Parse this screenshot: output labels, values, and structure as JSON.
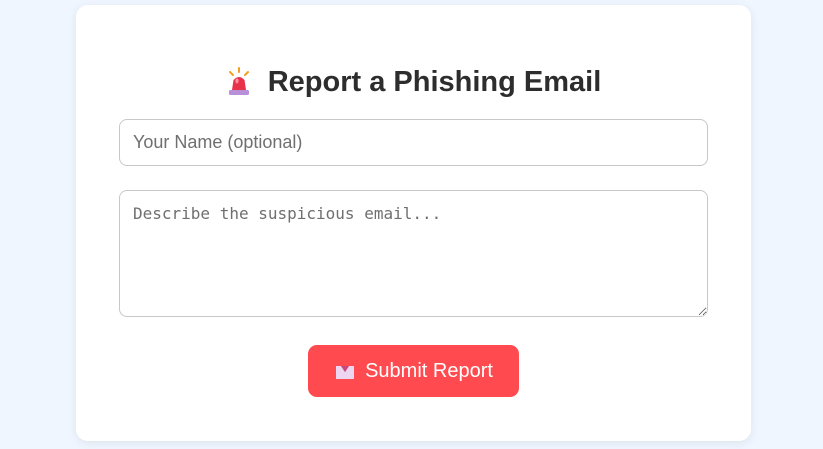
{
  "form": {
    "title": "Report a Phishing Email",
    "title_icon": "police-siren-icon",
    "name_placeholder": "Your Name (optional)",
    "name_value": "",
    "description_placeholder": "Describe the suspicious email...",
    "description_value": "",
    "submit_label": "Submit Report",
    "submit_icon": "inbox-tray-icon"
  },
  "colors": {
    "page_background": "#f0f6ff",
    "card_background": "#ffffff",
    "submit_button": "#ff4a4f",
    "title_text": "#2d2d2d"
  }
}
